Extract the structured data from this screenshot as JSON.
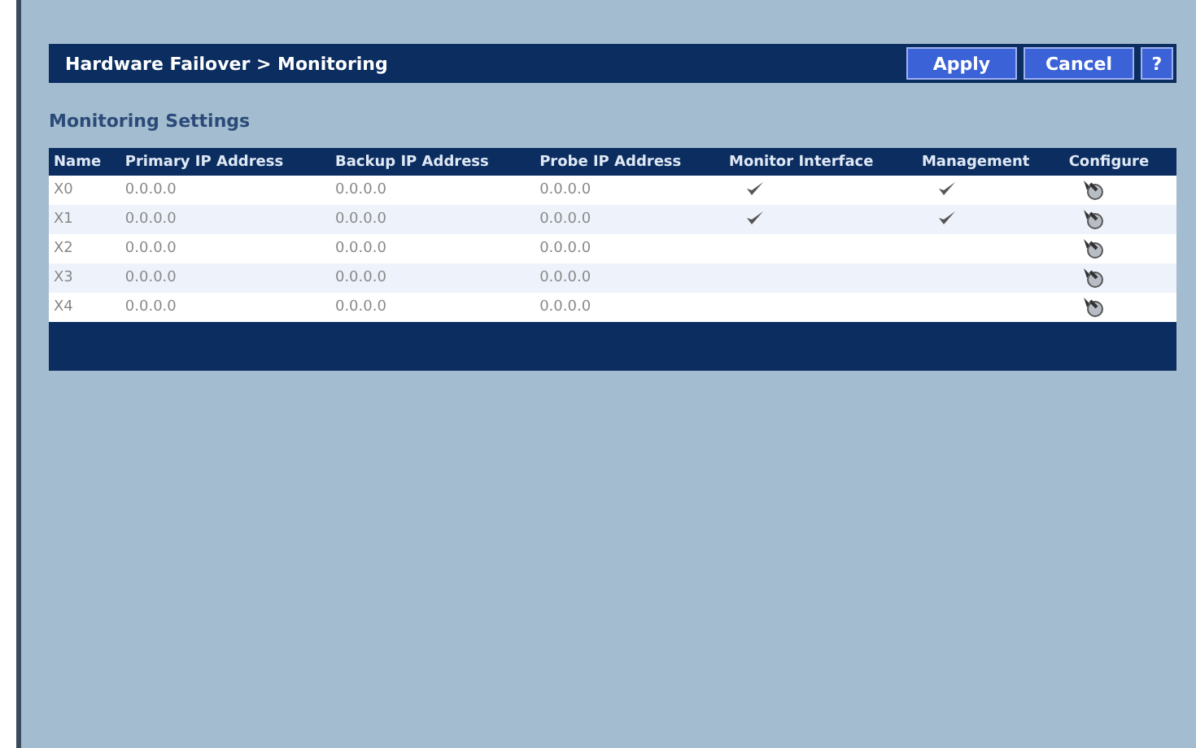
{
  "header": {
    "title": "Hardware Failover > Monitoring",
    "buttons": [
      "Apply",
      "Cancel"
    ],
    "help": "?"
  },
  "section_title": "Monitoring Settings",
  "table": {
    "columns": [
      "Name",
      "Primary IP Address",
      "Backup IP Address",
      "Probe IP Address",
      "Monitor Interface",
      "Management",
      "Configure"
    ],
    "rows": [
      {
        "name": "X0",
        "primary": "0.0.0.0",
        "backup": "0.0.0.0",
        "probe": "0.0.0.0",
        "monitor": true,
        "management": true
      },
      {
        "name": "X1",
        "primary": "0.0.0.0",
        "backup": "0.0.0.0",
        "probe": "0.0.0.0",
        "monitor": true,
        "management": true
      },
      {
        "name": "X2",
        "primary": "0.0.0.0",
        "backup": "0.0.0.0",
        "probe": "0.0.0.0",
        "monitor": false,
        "management": false
      },
      {
        "name": "X3",
        "primary": "0.0.0.0",
        "backup": "0.0.0.0",
        "probe": "0.0.0.0",
        "monitor": false,
        "management": false
      },
      {
        "name": "X4",
        "primary": "0.0.0.0",
        "backup": "0.0.0.0",
        "probe": "0.0.0.0",
        "monitor": false,
        "management": false
      }
    ]
  }
}
